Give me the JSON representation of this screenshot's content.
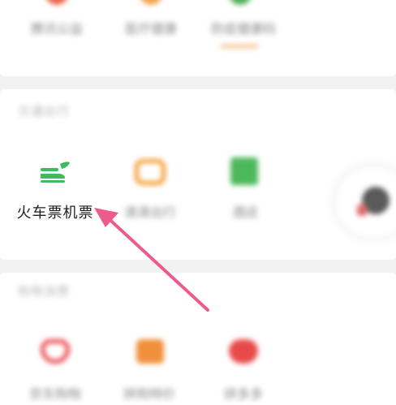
{
  "top_section": {
    "items": [
      {
        "label": "腾讯公益",
        "icon": "heart-hands-icon",
        "color": "#e8634a"
      },
      {
        "label": "医疗健康",
        "icon": "medical-icon",
        "color": "#f0a24a"
      },
      {
        "label": "防疫健康码",
        "icon": "health-code-icon",
        "color": "#4caf50"
      }
    ],
    "active_indicator_color": "#f5b97a"
  },
  "travel_section": {
    "title": "交通出行",
    "items": [
      {
        "label": "火车票机票",
        "icon": "train-plane-icon",
        "color": "#3dbb5e"
      },
      {
        "label": "滴滴出行",
        "icon": "didi-icon",
        "color": "#f59a2e"
      },
      {
        "label": "酒店",
        "icon": "hotel-icon",
        "color": "#4cb85c"
      }
    ]
  },
  "shopping_section": {
    "title": "购物消费",
    "items": [
      {
        "label": "京东购物",
        "icon": "jd-icon",
        "color": "#e8434a"
      },
      {
        "label": "拼购特价",
        "icon": "pinduoduo-icon",
        "color": "#f0903a"
      },
      {
        "label": "拼多多",
        "icon": "heart-icon",
        "color": "#e84a4a"
      }
    ]
  },
  "floating_button": {
    "icon": "floating-assistant-icon"
  },
  "annotation": {
    "arrow_color": "#ee5a8a"
  }
}
